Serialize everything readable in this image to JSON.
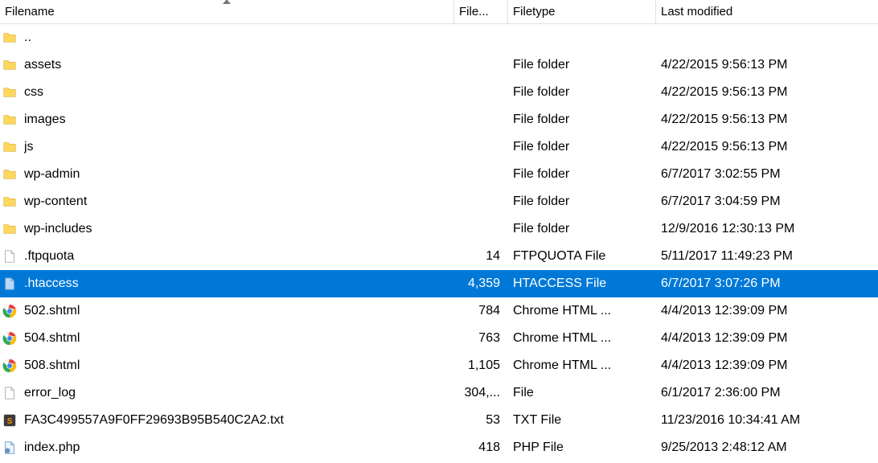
{
  "columns": {
    "filename": "Filename",
    "filesize": "File...",
    "filetype": "Filetype",
    "lastmodified": "Last modified"
  },
  "sort": {
    "column": "filename",
    "direction": "asc"
  },
  "selected_index": 9,
  "files": [
    {
      "icon": "folder",
      "name": "..",
      "size": "",
      "type": "",
      "modified": ""
    },
    {
      "icon": "folder",
      "name": "assets",
      "size": "",
      "type": "File folder",
      "modified": "4/22/2015 9:56:13 PM"
    },
    {
      "icon": "folder",
      "name": "css",
      "size": "",
      "type": "File folder",
      "modified": "4/22/2015 9:56:13 PM"
    },
    {
      "icon": "folder",
      "name": "images",
      "size": "",
      "type": "File folder",
      "modified": "4/22/2015 9:56:13 PM"
    },
    {
      "icon": "folder",
      "name": "js",
      "size": "",
      "type": "File folder",
      "modified": "4/22/2015 9:56:13 PM"
    },
    {
      "icon": "folder",
      "name": "wp-admin",
      "size": "",
      "type": "File folder",
      "modified": "6/7/2017 3:02:55 PM"
    },
    {
      "icon": "folder",
      "name": "wp-content",
      "size": "",
      "type": "File folder",
      "modified": "6/7/2017 3:04:59 PM"
    },
    {
      "icon": "folder",
      "name": "wp-includes",
      "size": "",
      "type": "File folder",
      "modified": "12/9/2016 12:30:13 PM"
    },
    {
      "icon": "file",
      "name": ".ftpquota",
      "size": "14",
      "type": "FTPQUOTA File",
      "modified": "5/11/2017 11:49:23 PM"
    },
    {
      "icon": "file-blue",
      "name": ".htaccess",
      "size": "4,359",
      "type": "HTACCESS File",
      "modified": "6/7/2017 3:07:26 PM"
    },
    {
      "icon": "chrome",
      "name": "502.shtml",
      "size": "784",
      "type": "Chrome HTML ...",
      "modified": "4/4/2013 12:39:09 PM"
    },
    {
      "icon": "chrome",
      "name": "504.shtml",
      "size": "763",
      "type": "Chrome HTML ...",
      "modified": "4/4/2013 12:39:09 PM"
    },
    {
      "icon": "chrome",
      "name": "508.shtml",
      "size": "1,105",
      "type": "Chrome HTML ...",
      "modified": "4/4/2013 12:39:09 PM"
    },
    {
      "icon": "file",
      "name": "error_log",
      "size": "304,...",
      "type": "File",
      "modified": "6/1/2017 2:36:00 PM"
    },
    {
      "icon": "sublime",
      "name": "FA3C499557A9F0FF29693B95B540C2A2.txt",
      "size": "53",
      "type": "TXT File",
      "modified": "11/23/2016 10:34:41 AM"
    },
    {
      "icon": "php",
      "name": "index.php",
      "size": "418",
      "type": "PHP File",
      "modified": "9/25/2013 2:48:12 AM"
    }
  ]
}
